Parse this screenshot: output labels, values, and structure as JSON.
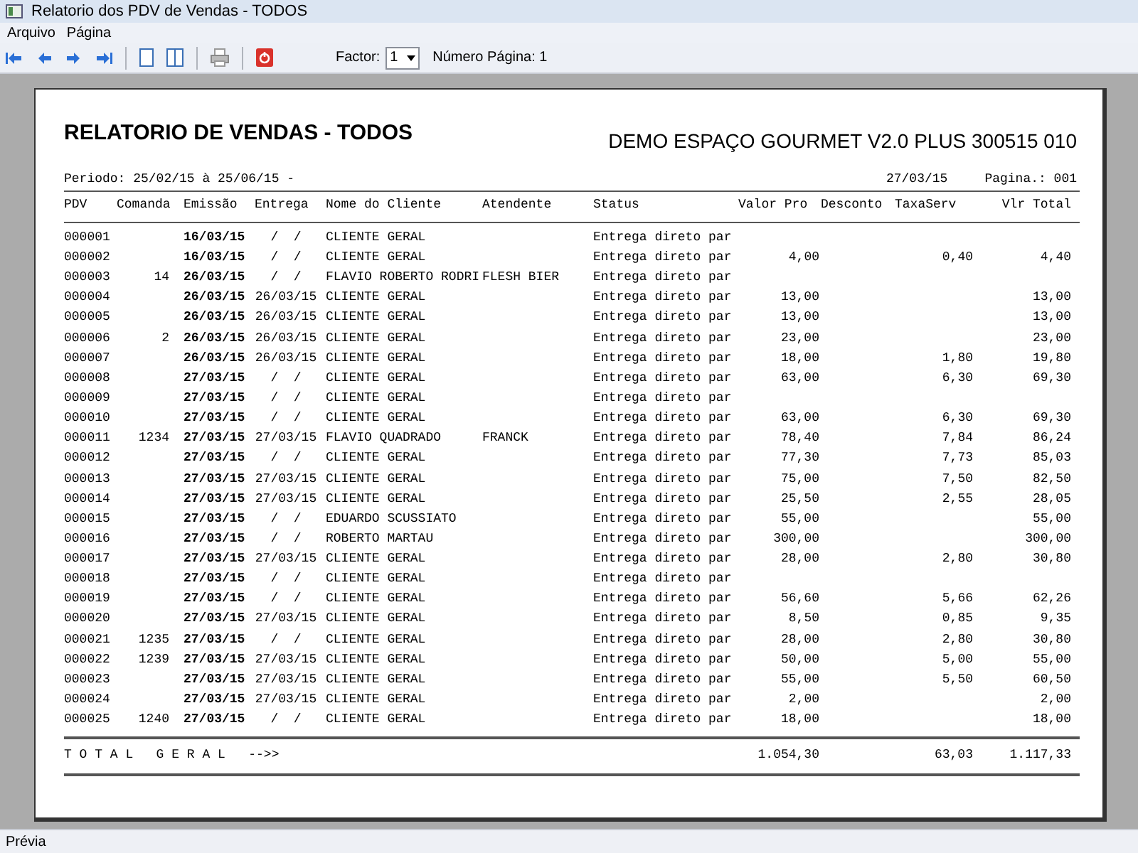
{
  "window": {
    "title": "Relatorio dos PDV de Vendas  - TODOS"
  },
  "menu": [
    "Arquivo",
    "Página"
  ],
  "toolbar": {
    "factor_label": "Factor:",
    "factor_value": "1",
    "page_label": "Número Página: 1"
  },
  "report": {
    "title": "RELATORIO DE VENDAS  - TODOS",
    "company": "DEMO ESPAÇO GOURMET V2.0 PLUS 300515 010",
    "period": "Periodo: 25/02/15 à 25/06/15 -",
    "date": "27/03/15",
    "page": "Pagina.: 001",
    "columns": [
      "PDV",
      "Comanda",
      "Emissão",
      "Entrega",
      "Nome do Cliente",
      "Atendente",
      "Status",
      "Valor Pro",
      "Desconto",
      "TaxaServ",
      "Vlr Total"
    ],
    "rows": [
      {
        "pdv": "000001",
        "emissao": "16/03/15",
        "entrega": "/  /",
        "cliente": "CLIENTE GERAL",
        "status": "Entrega direto par"
      },
      {
        "pdv": "000002",
        "emissao": "16/03/15",
        "entrega": "/  /",
        "cliente": "CLIENTE GERAL",
        "status": "Entrega direto par",
        "valor": "4,00",
        "taxa": "0,40",
        "total": "4,40"
      },
      {
        "pdv": "000003",
        "comanda": "14",
        "emissao": "26/03/15",
        "entrega": "/  /",
        "cliente": "FLAVIO ROBERTO RODRI",
        "atendente": "FLESH BIER",
        "status": "Entrega direto par"
      },
      {
        "pdv": "000004",
        "emissao": "26/03/15",
        "entrega": "26/03/15",
        "cliente": "CLIENTE GERAL",
        "status": "Entrega direto par",
        "valor": "13,00",
        "total": "13,00"
      },
      {
        "pdv": "000005",
        "emissao": "26/03/15",
        "entrega": "26/03/15",
        "cliente": "CLIENTE GERAL",
        "status": "Entrega direto par",
        "valor": "13,00",
        "total": "13,00"
      },
      {
        "pdv": "000006",
        "comanda": "2",
        "emissao": "26/03/15",
        "entrega": "26/03/15",
        "cliente": "CLIENTE GERAL",
        "status": "Entrega direto par",
        "valor": "23,00",
        "total": "23,00"
      },
      {
        "pdv": "000007",
        "emissao": "26/03/15",
        "entrega": "26/03/15",
        "cliente": "CLIENTE GERAL",
        "status": "Entrega direto par",
        "valor": "18,00",
        "taxa": "1,80",
        "total": "19,80"
      },
      {
        "pdv": "000008",
        "emissao": "27/03/15",
        "entrega": "/  /",
        "cliente": "CLIENTE GERAL",
        "status": "Entrega direto par",
        "valor": "63,00",
        "taxa": "6,30",
        "total": "69,30"
      },
      {
        "pdv": "000009",
        "emissao": "27/03/15",
        "entrega": "/  /",
        "cliente": "CLIENTE GERAL",
        "status": "Entrega direto par"
      },
      {
        "pdv": "000010",
        "emissao": "27/03/15",
        "entrega": "/  /",
        "cliente": "CLIENTE GERAL",
        "status": "Entrega direto par",
        "valor": "63,00",
        "taxa": "6,30",
        "total": "69,30"
      },
      {
        "pdv": "000011",
        "comanda": "1234",
        "emissao": "27/03/15",
        "entrega": "27/03/15",
        "cliente": "FLAVIO QUADRADO",
        "atendente": "FRANCK",
        "status": "Entrega direto par",
        "valor": "78,40",
        "taxa": "7,84",
        "total": "86,24"
      },
      {
        "pdv": "000012",
        "emissao": "27/03/15",
        "entrega": "/  /",
        "cliente": "CLIENTE GERAL",
        "status": "Entrega direto par",
        "valor": "77,30",
        "taxa": "7,73",
        "total": "85,03"
      },
      {
        "pdv": "000013",
        "emissao": "27/03/15",
        "entrega": "27/03/15",
        "cliente": "CLIENTE GERAL",
        "status": "Entrega direto par",
        "valor": "75,00",
        "taxa": "7,50",
        "total": "82,50"
      },
      {
        "pdv": "000014",
        "emissao": "27/03/15",
        "entrega": "27/03/15",
        "cliente": "CLIENTE GERAL",
        "status": "Entrega direto par",
        "valor": "25,50",
        "taxa": "2,55",
        "total": "28,05"
      },
      {
        "pdv": "000015",
        "emissao": "27/03/15",
        "entrega": "/  /",
        "cliente": "EDUARDO SCUSSIATO",
        "status": "Entrega direto par",
        "valor": "55,00",
        "total": "55,00"
      },
      {
        "pdv": "000016",
        "emissao": "27/03/15",
        "entrega": "/  /",
        "cliente": "ROBERTO MARTAU",
        "status": "Entrega direto par",
        "valor": "300,00",
        "total": "300,00"
      },
      {
        "pdv": "000017",
        "emissao": "27/03/15",
        "entrega": "27/03/15",
        "cliente": "CLIENTE GERAL",
        "status": "Entrega direto par",
        "valor": "28,00",
        "taxa": "2,80",
        "total": "30,80"
      },
      {
        "pdv": "000018",
        "emissao": "27/03/15",
        "entrega": "/  /",
        "cliente": "CLIENTE GERAL",
        "status": "Entrega direto par"
      },
      {
        "pdv": "000019",
        "emissao": "27/03/15",
        "entrega": "/  /",
        "cliente": "CLIENTE GERAL",
        "status": "Entrega direto par",
        "valor": "56,60",
        "taxa": "5,66",
        "total": "62,26"
      },
      {
        "pdv": "000020",
        "emissao": "27/03/15",
        "entrega": "27/03/15",
        "cliente": "CLIENTE GERAL",
        "status": "Entrega direto par",
        "valor": "8,50",
        "taxa": "0,85",
        "total": "9,35"
      },
      {
        "pdv": "000021",
        "comanda": "1235",
        "emissao": "27/03/15",
        "entrega": "/  /",
        "cliente": "CLIENTE GERAL",
        "status": "Entrega direto par",
        "valor": "28,00",
        "taxa": "2,80",
        "total": "30,80"
      },
      {
        "pdv": "000022",
        "comanda": "1239",
        "emissao": "27/03/15",
        "entrega": "27/03/15",
        "cliente": "CLIENTE GERAL",
        "status": "Entrega direto par",
        "valor": "50,00",
        "taxa": "5,00",
        "total": "55,00"
      },
      {
        "pdv": "000023",
        "emissao": "27/03/15",
        "entrega": "27/03/15",
        "cliente": "CLIENTE GERAL",
        "status": "Entrega direto par",
        "valor": "55,00",
        "taxa": "5,50",
        "total": "60,50"
      },
      {
        "pdv": "000024",
        "emissao": "27/03/15",
        "entrega": "27/03/15",
        "cliente": "CLIENTE GERAL",
        "status": "Entrega direto par",
        "valor": "2,00",
        "total": "2,00"
      },
      {
        "pdv": "000025",
        "comanda": "1240",
        "emissao": "27/03/15",
        "entrega": "/  /",
        "cliente": "CLIENTE GERAL",
        "status": "Entrega direto par",
        "valor": "18,00",
        "total": "18,00"
      }
    ],
    "totals": {
      "label": "T O T A L   G E R A L   -->>",
      "valor": "1.054,30",
      "taxa": "63,03",
      "total": "1.117,33"
    }
  },
  "status_bar": "Prévia"
}
